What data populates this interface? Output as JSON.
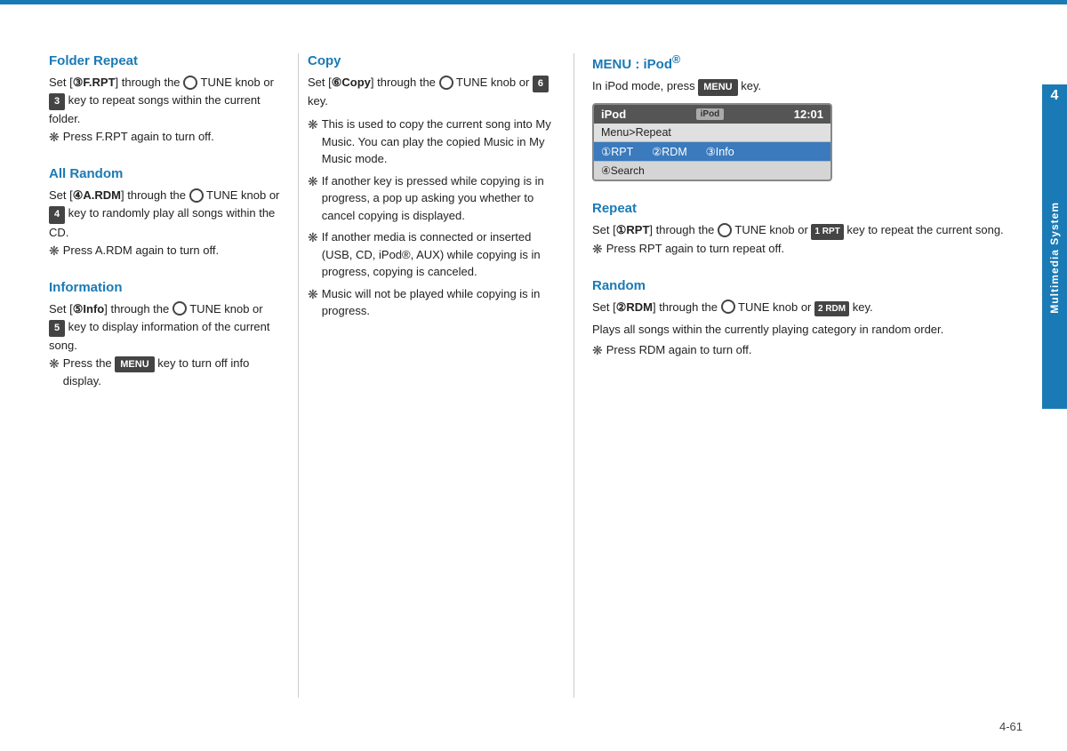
{
  "page": {
    "top_line_color": "#1a7ab5",
    "page_number": "4-61",
    "side_tab_number": "4",
    "side_tab_label": "Multimedia System"
  },
  "left_col": {
    "folder_repeat": {
      "title": "Folder Repeat",
      "para1": "Set [③F.RPT] through the ⊙ TUNE knob or",
      "key1": "3",
      "para1b": "key to repeat songs within the current folder.",
      "note1": "Press F.RPT again to turn off."
    },
    "all_random": {
      "title": "All Random",
      "para1": "Set [④A.RDM] through the ⊙ TUNE knob or",
      "key1": "4",
      "para1b": "key to randomly play all songs within the CD.",
      "note1": "Press A.RDM again to turn off."
    },
    "information": {
      "title": "Information",
      "para1": "Set [⑤Info] through the ⊙ TUNE knob or",
      "key1": "5",
      "para1b": "key to display information of the current song.",
      "note1_pre": "Press the",
      "note1_menu": "MENU",
      "note1_post": "key to turn off info display."
    }
  },
  "mid_col": {
    "copy": {
      "title": "Copy",
      "para1_pre": "Set [⑥Copy] through the ⊙ TUNE knob or",
      "key1": "6",
      "para1b": "key.",
      "notes": [
        "This is used to copy the current song into My Music. You can play the copied Music in My Music mode.",
        "If another key is pressed while copying is in progress, a pop up asking you whether to cancel copying is displayed.",
        "If another media is connected or inserted (USB, CD, iPod®, AUX) while copying is in progress, copying is canceled.",
        "Music will not be played while copying is in progress."
      ]
    }
  },
  "right_col": {
    "menu_ipod": {
      "title": "MENU : iPod®",
      "para1": "In iPod mode, press",
      "menu_badge": "MENU",
      "para1b": "key.",
      "screen": {
        "header_left": "iPod",
        "header_badge": "iPod",
        "header_time": "12:01",
        "row1": "Menu>Repeat",
        "row2_items": [
          "①RPT",
          "②RDM",
          "③Info"
        ],
        "row3": "④Search"
      }
    },
    "repeat": {
      "title": "Repeat",
      "para1_pre": "Set [①RPT] through the ⊙ TUNE knob or",
      "key_badge": "1 RPT",
      "para1b": "key to repeat the current song.",
      "note1": "Press RPT again to turn repeat off."
    },
    "random": {
      "title": "Random",
      "para1_pre": "Set [②RDM] through the ⊙ TUNE knob or",
      "key_badge": "2 RDM",
      "para1b": "key.",
      "para2": "Plays all songs within the currently playing category in random order.",
      "note1": "Press RDM again to turn off."
    }
  }
}
